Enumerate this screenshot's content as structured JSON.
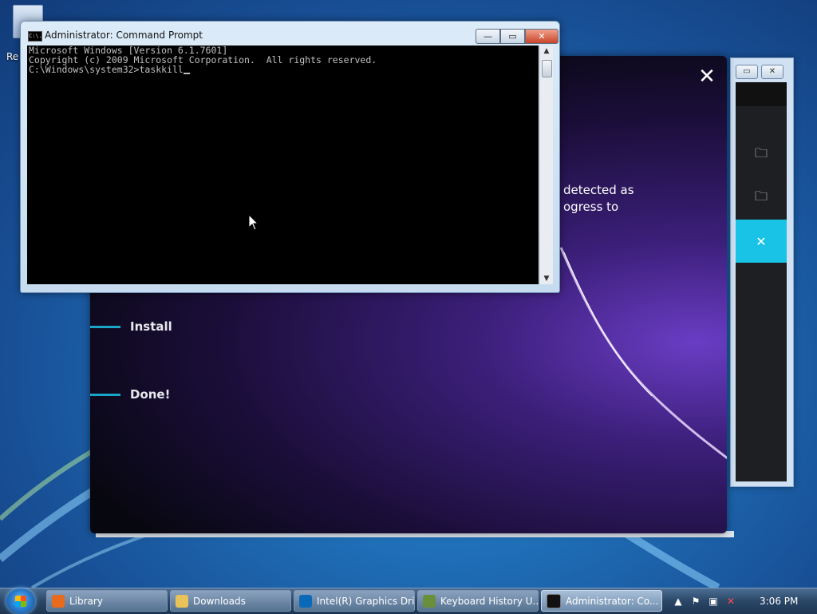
{
  "desktop": {
    "recycle_bin_label": "Re"
  },
  "explorer_window": {
    "caption_buttons": [
      "▭",
      "✕"
    ],
    "items": [
      {
        "icon": "folder-icon",
        "glyph": "🗀"
      },
      {
        "icon": "folder-icon",
        "glyph": "🗀"
      },
      {
        "icon": "close-icon",
        "glyph": "✕"
      }
    ]
  },
  "installer": {
    "close_glyph": "✕",
    "message_line1": "detected as",
    "message_line2": "ogress to",
    "steps": [
      {
        "label": "Install"
      },
      {
        "label": "Done!"
      }
    ]
  },
  "cmd_window": {
    "title": "Administrator: Command Prompt",
    "icon_text": "C:\\.",
    "buttons": {
      "minimize": "—",
      "maximize": "▭",
      "close": "✕"
    },
    "lines": [
      "Microsoft Windows [Version 6.1.7601]",
      "Copyright (c) 2009 Microsoft Corporation.  All rights reserved.",
      "",
      "C:\\Windows\\system32>taskkill"
    ]
  },
  "taskbar": {
    "tasks": [
      {
        "label": "Library",
        "icon": "firefox-icon",
        "color": "#e86a1c",
        "active": false
      },
      {
        "label": "Downloads",
        "icon": "folder-icon",
        "color": "#e9c25a",
        "active": false
      },
      {
        "label": "Intel(R) Graphics Dri...",
        "icon": "intel-icon",
        "color": "#0a6ab8",
        "active": false
      },
      {
        "label": "Keyboard History U...",
        "icon": "keyboard-history-icon",
        "color": "#6a8f3a",
        "active": false
      },
      {
        "label": "Administrator: Co...",
        "icon": "cmd-icon",
        "color": "#111111",
        "active": true
      }
    ],
    "tray": {
      "time": "3:06 PM",
      "icons": [
        "show-hidden-icons-arrow",
        "action-center-flag-icon",
        "network-icon",
        "volume-muted-icon"
      ]
    }
  }
}
